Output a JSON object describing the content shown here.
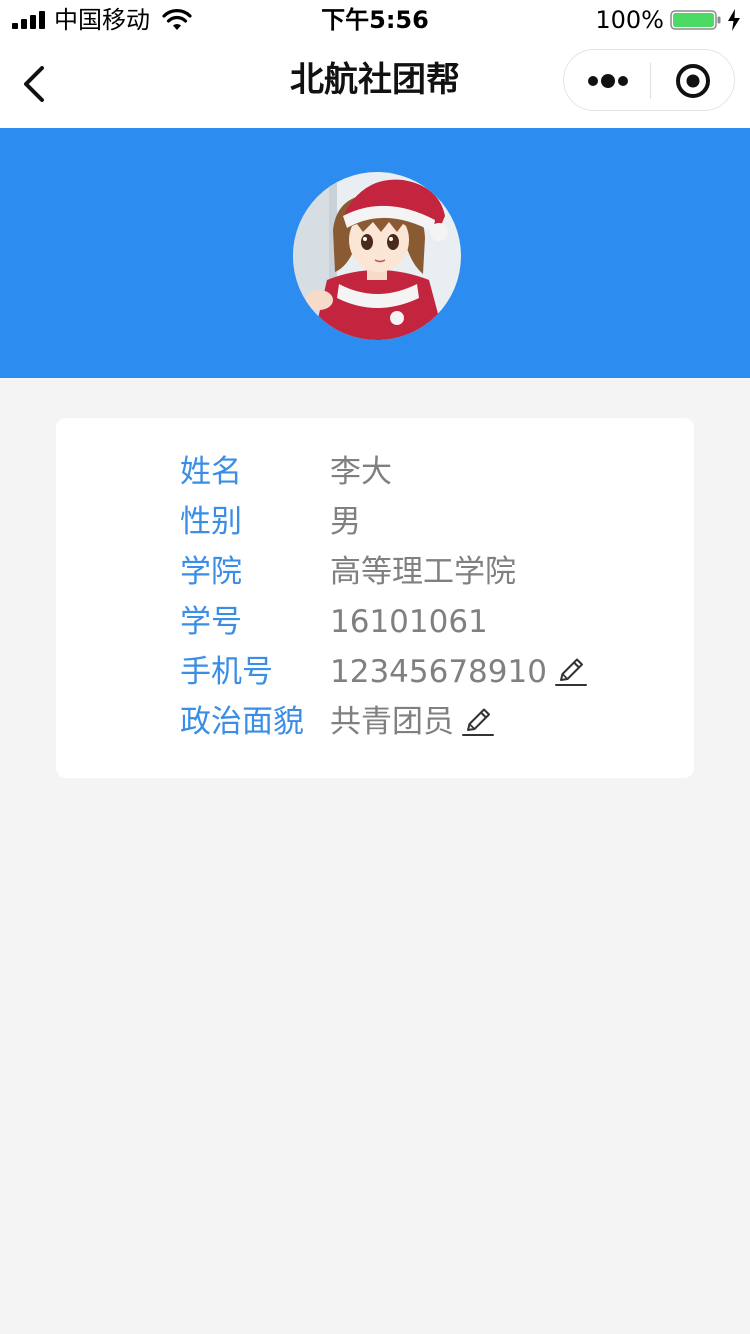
{
  "status_bar": {
    "carrier": "中国移动",
    "time": "下午5:56",
    "battery_percent": "100%",
    "battery_level": 1.0,
    "icons": [
      "signal-icon",
      "wifi-icon",
      "battery-icon",
      "charging-icon"
    ]
  },
  "nav": {
    "title": "北航社团帮",
    "back_icon": "chevron-left-icon",
    "more_icon": "more-dots-icon",
    "close_icon": "target-close-icon"
  },
  "colors": {
    "banner": "#2d8cf0",
    "label": "#3a8ee6",
    "value": "#808080",
    "page_bg": "#f4f4f4",
    "card_bg": "#ffffff"
  },
  "profile": {
    "avatar": "user-avatar-image",
    "rows": [
      {
        "label": "姓名",
        "value": "李大",
        "editable": false
      },
      {
        "label": "性别",
        "value": "男",
        "editable": false
      },
      {
        "label": "学院",
        "value": "高等理工学院",
        "editable": false
      },
      {
        "label": "学号",
        "value": "16101061",
        "editable": false
      },
      {
        "label": "手机号",
        "value": "12345678910",
        "editable": true
      },
      {
        "label": "政治面貌",
        "value": "共青团员",
        "editable": true
      }
    ],
    "edit_icon": "pencil-edit-icon"
  }
}
